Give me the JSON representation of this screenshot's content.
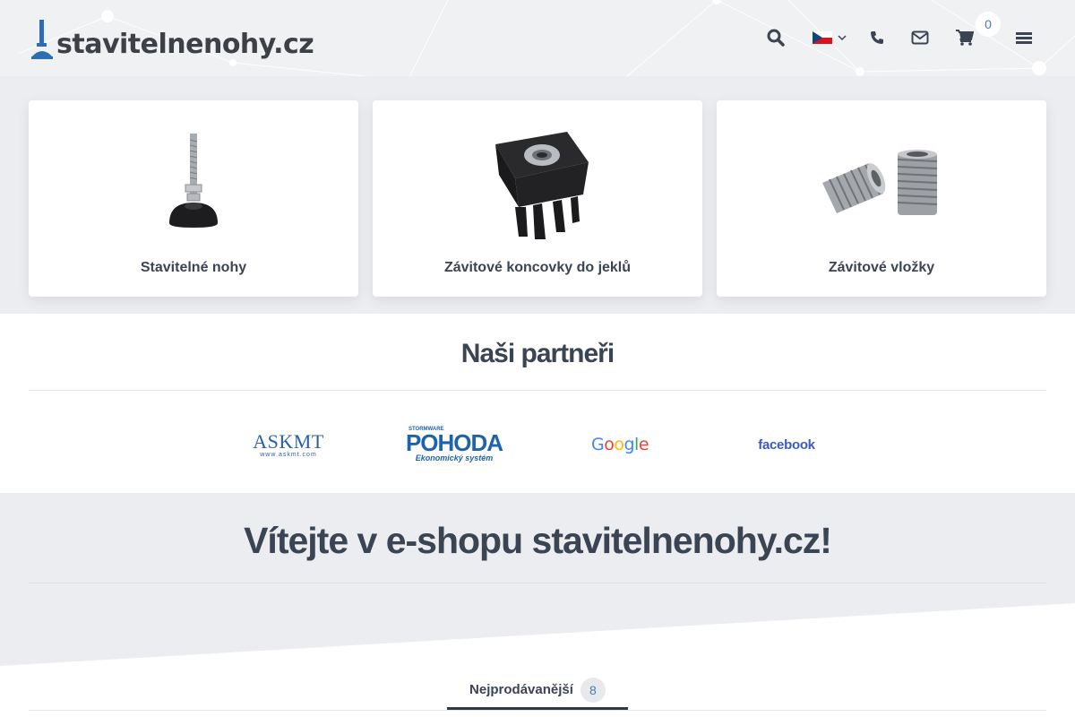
{
  "header": {
    "logo_text": "stavitelnenohy.cz",
    "icons": [
      "search-icon",
      "czech-flag-icon",
      "chevron-down-icon",
      "phone-icon",
      "envelope-icon",
      "cart-icon",
      "menu-icon"
    ],
    "cart_count": "0"
  },
  "categories": [
    {
      "title": "Stavitelné nohy",
      "image": "adjustable-foot-image"
    },
    {
      "title": "Závitové koncovky do jeklů",
      "image": "square-tube-insert-image"
    },
    {
      "title": "Závitové vložky",
      "image": "threaded-inserts-image"
    }
  ],
  "partners": {
    "title": "Naši partneři",
    "logos": [
      {
        "name": "ASKMT",
        "sub": "www.askmt.com"
      },
      {
        "name": "POHODA",
        "sup": "STORMWARE",
        "sub": "Ekonomický systém"
      },
      {
        "name": "Google"
      },
      {
        "name": "facebook"
      }
    ]
  },
  "welcome": {
    "title": "Vítejte v e-shopu stavitelnenohy.cz!",
    "tab_label": "Nejprodávanější",
    "tab_count": "8"
  },
  "colors": {
    "text": "#3a4453",
    "accent": "#4a7bb7",
    "background": "#ebedf0",
    "card": "#ffffff"
  }
}
